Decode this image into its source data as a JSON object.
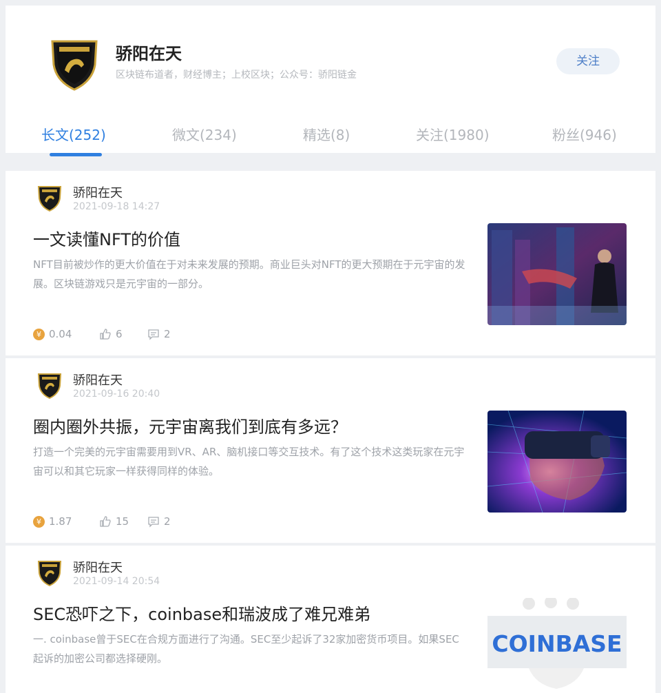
{
  "profile": {
    "name": "骄阳在天",
    "description": "区块链布道者，财经博主；上校区块；公众号：骄阳链金",
    "follow_label": "关注"
  },
  "tabs": [
    {
      "label": "长文(252)",
      "active": true
    },
    {
      "label": "微文(234)",
      "active": false
    },
    {
      "label": "精选(8)",
      "active": false
    },
    {
      "label": "关注(1980)",
      "active": false
    },
    {
      "label": "粉丝(946)",
      "active": false
    }
  ],
  "articles": [
    {
      "author": "骄阳在天",
      "date": "2021-09-18 14:27",
      "title": "一文读懂NFT的价值",
      "summary": "NFT目前被炒作的更大价值在于对未来发展的预期。商业巨头对NFT的更大预期在于元宇宙的发展。区块链游戏只是元宇宙的一部分。",
      "coin": "0.04",
      "likes": "6",
      "comments": "2",
      "thumb_icon": "cyberpunk-city-image"
    },
    {
      "author": "骄阳在天",
      "date": "2021-09-16 20:40",
      "title": "圈内圈外共振，元宇宙离我们到底有多远？",
      "summary": "打造一个完美的元宇宙需要用到VR、AR、脑机接口等交互技术。有了这个技术这类玩家在元宇宙可以和其它玩家一样获得同样的体验。",
      "coin": "1.87",
      "likes": "15",
      "comments": "2",
      "thumb_icon": "vr-headset-image"
    },
    {
      "author": "骄阳在天",
      "date": "2021-09-14 20:54",
      "title": "SEC恐吓之下，coinbase和瑞波成了难兄难弟",
      "summary": "一. coinbase曾于SEC在合规方面进行了沟通。SEC至少起诉了32家加密货币项目。如果SEC起诉的加密公司都选择硬刚。",
      "thumb_text": "COINBASE",
      "thumb_icon": "coinbase-sign-image"
    }
  ],
  "colors": {
    "accent": "#2f7fe0",
    "coin": "#e8a33e",
    "muted": "#9ea2a8"
  }
}
